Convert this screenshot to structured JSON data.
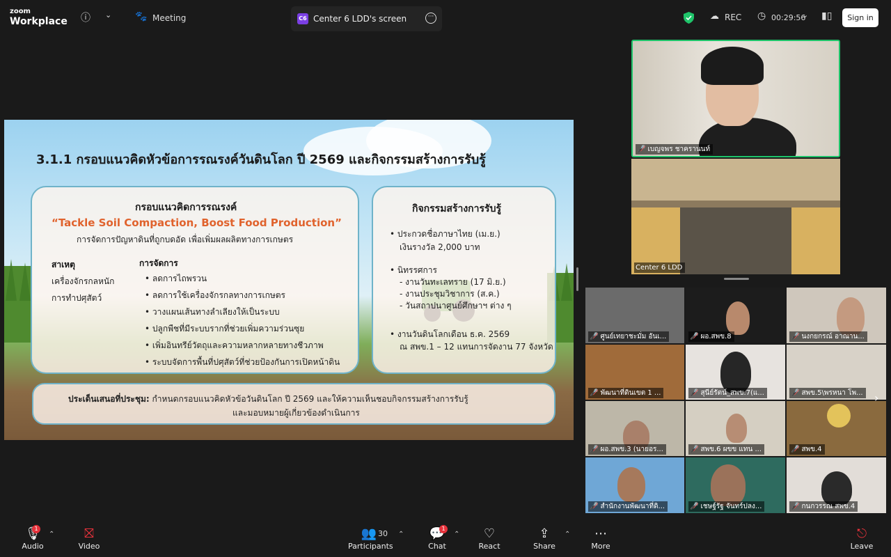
{
  "app": {
    "brand_top": "zoom",
    "brand_bottom": "Workplace"
  },
  "topbar": {
    "meeting_label": "Meeting",
    "screen_badge": "C6",
    "screen_label": "Center 6 LDD's screen",
    "rec_label": "REC",
    "timer": "00:29:56",
    "signin_label": "Sign in"
  },
  "slide": {
    "title": "3.1.1  กรอบแนวคิดหัวข้อการรณรงค์วันดินโลก ปี 2569 และกิจกรรมสร้างการรับรู้",
    "left_panel": {
      "title": "กรอบแนวคิดการรณรงค์",
      "slogan": "“Tackle Soil Compaction, Boost Food Production”",
      "subtitle": "การจัดการปัญหาดินที่ถูกบดอัด เพื่อเพิ่มผลผลิตทางการเกษตร",
      "cause_heading": "สาเหตุ",
      "causes": [
        "เครื่องจักรกลหนัก",
        "การทำปศุสัตว์"
      ],
      "manage_heading": "การจัดการ",
      "management": [
        "ลดการไถพรวน",
        "ลดการใช้เครื่องจักรกลทางการเกษตร",
        "วางแผนเส้นทางลำเลียงให้เป็นระบบ",
        "ปลูกพืชที่มีระบบรากที่ช่วยเพิ่มความร่วนซุย",
        "เพิ่มอินทรีย์วัตถุและความหลากหลายทางชีวภาพ",
        "ระบบจัดการพื้นที่ปศุสัตว์ที่ช่วยป้องกันการเปิดหน้าดิน"
      ]
    },
    "right_panel": {
      "title": "กิจกรรมสร้างการรับรู้",
      "item1_line1": "ประกวดชื่อภาษาไทย  (เม.ย.)",
      "item1_line2": "เงินรางวัล 2,000 บาท",
      "item2_line1": "นิทรรศการ",
      "item2_sub": [
        "- งานวันทะเลทราย (17 มิ.ย.)",
        "- งานประชุมวิชาการ (ส.ค.)",
        "- วันสถาปนาศูนย์ศึกษาฯ ต่าง ๆ"
      ],
      "item3_line1": "งานวันดินโลกเดือน ธ.ค. 2569",
      "item3_line2": "ณ สพข.1 – 12 แทนการจัดงาน 77 จังหวัด"
    },
    "bottom_panel": {
      "label": "ประเด็นเสนอที่ประชุม:",
      "line1": " กำหนดกรอบแนวคิดหัวข้อวันดินโลก ปี 2569 และให้ความเห็นชอบกิจกรรมสร้างการรับรู้",
      "line2": "และมอบหมายผู้เกี่ยวข้องดำเนินการ"
    }
  },
  "videos": {
    "speaker_name": "เบญจพร ชาครานนท์",
    "room_name": "Center 6 LDD",
    "grid": [
      "ศูนย์เทยาชะมั่ม อันเ...",
      "ผอ.สพข.8",
      "นงกยกรณ์ อาณาน...",
      "พัฒนาที่ดินเขต 1 ...",
      "สุนีย์รัตน์_สพข.7(แ...",
      "สพข.5\\พรหนา โพ...",
      "ผอ.สพข.3 (นายอร...",
      "สพข.6 ผขข แทน ...",
      "สพข.4",
      "สำนักงานพัฒนาที่ดิ...",
      "เชษฐ์รัฐ จันทร์ปลง...",
      "กนกวรรณ สพข.4"
    ]
  },
  "bottombar": {
    "audio": "Audio",
    "audio_badge": "1",
    "video": "Video",
    "participants": "Participants",
    "participants_count": "30",
    "chat": "Chat",
    "chat_badge": "1",
    "react": "React",
    "share": "Share",
    "more": "More",
    "leave": "Leave"
  },
  "colors": {
    "accent_green": "#1fc46a",
    "slogan_orange": "#e0632d",
    "leave_red": "#e5323b"
  }
}
